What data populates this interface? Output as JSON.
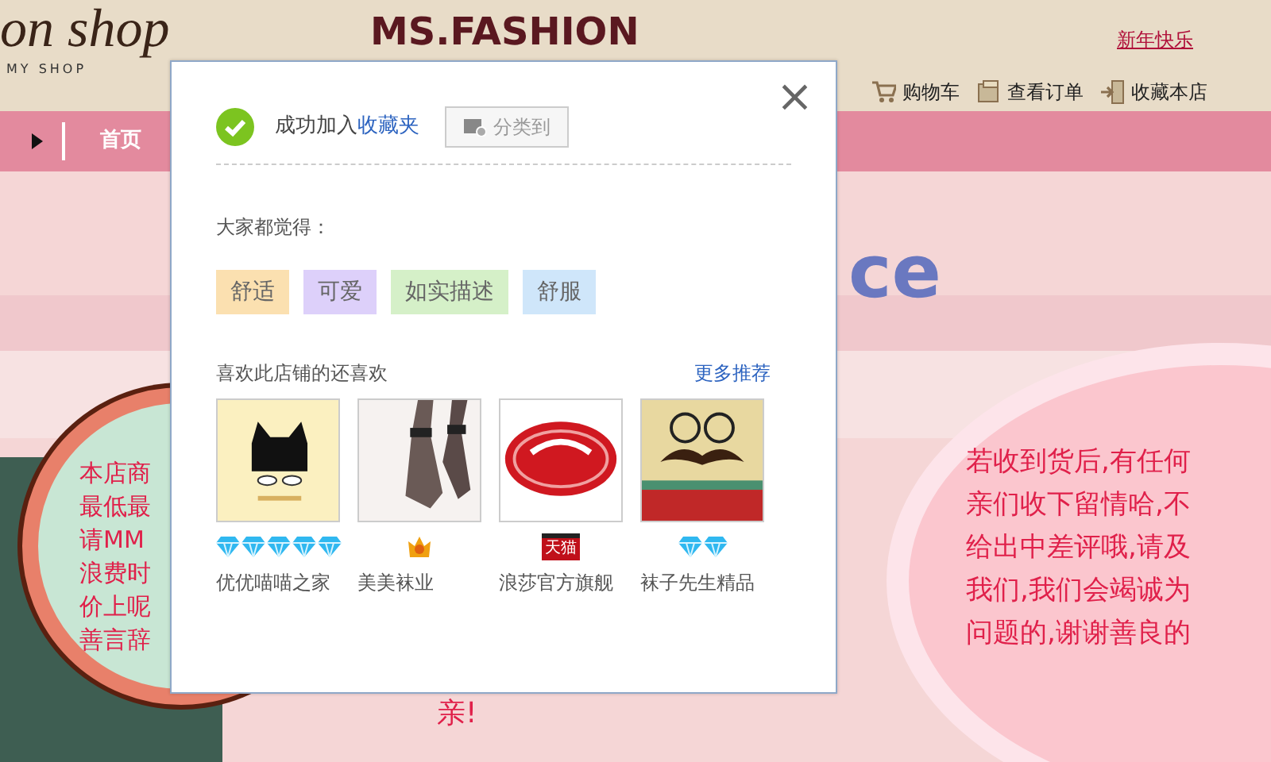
{
  "header": {
    "logo": "on shop",
    "logo_sub": "MY SHOP",
    "title": "MS.FASHION",
    "greeting": "新年快乐",
    "links": [
      {
        "kind": "cart",
        "label": "购物车"
      },
      {
        "kind": "orders",
        "label": "查看订单"
      },
      {
        "kind": "favorite",
        "label": "收藏本店"
      }
    ]
  },
  "nav": {
    "items": [
      {
        "label": "首页",
        "selected": true
      }
    ]
  },
  "banner": {
    "heading_fragment": "ce",
    "left_notice": [
      "本店商",
      "最低最",
      "请MM",
      "浪费时",
      "价上呢",
      "善言辞"
    ],
    "right_notice": [
      "若收到货后,有任何",
      "亲们收下留情哈,不",
      "给出中差评哦,请及",
      "我们,我们会竭诚为",
      "问题的,谢谢善良的"
    ],
    "bottom_text": "亲!"
  },
  "dialog": {
    "message": "成功加入",
    "link": "收藏夹",
    "category_button": "分类到",
    "close": "×",
    "tags_title": "大家都觉得：",
    "tags": [
      {
        "label": "舒适",
        "color": "#fbe0b0"
      },
      {
        "label": "可爱",
        "color": "#ddd0fa"
      },
      {
        "label": "如实描述",
        "color": "#d5f0c8"
      },
      {
        "label": "舒服",
        "color": "#cfe6fa"
      }
    ],
    "recommend_title": "喜欢此店铺的还喜欢",
    "more_link": "更多推荐",
    "shops": [
      {
        "name": "优优喵喵之家",
        "rank": [
          {
            "kind": "diamond"
          },
          {
            "kind": "diamond"
          },
          {
            "kind": "diamond"
          },
          {
            "kind": "diamond"
          },
          {
            "kind": "diamond"
          }
        ]
      },
      {
        "name": "美美袜业",
        "rank": [
          {
            "kind": "crown"
          }
        ]
      },
      {
        "name": "浪莎官方旗舰",
        "rank": [
          {
            "kind": "tmall",
            "label": "天猫"
          }
        ]
      },
      {
        "name": "袜子先生精品",
        "rank": [
          {
            "kind": "diamond"
          },
          {
            "kind": "diamond"
          }
        ]
      }
    ]
  }
}
